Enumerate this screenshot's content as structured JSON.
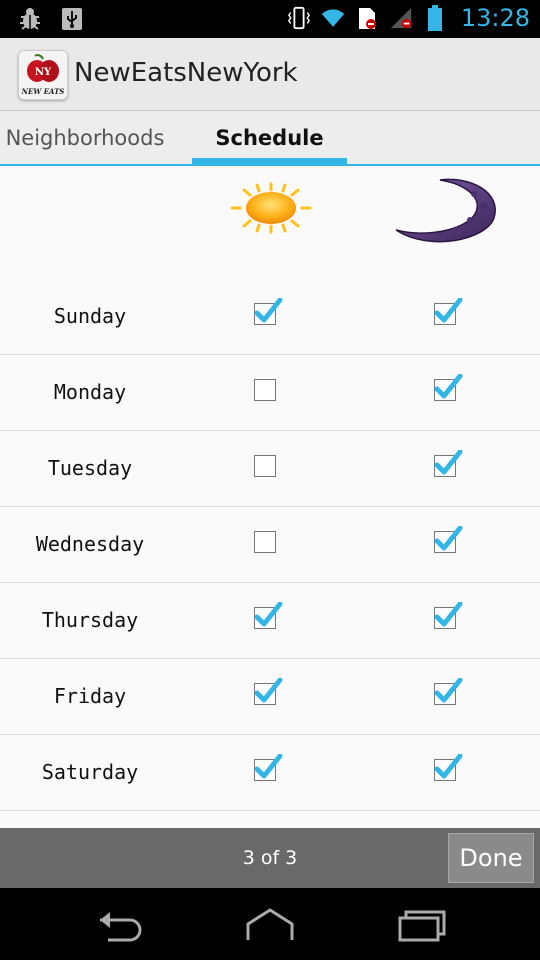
{
  "status_bar": {
    "time": "13:28",
    "left_icons": [
      "bug-icon",
      "usb-icon"
    ],
    "right_icons": [
      "vibrate-icon",
      "wifi-icon",
      "sd-card-icon",
      "no-signal-icon",
      "battery-icon"
    ],
    "accent": "#33b5e5"
  },
  "app": {
    "title": "NewEatsNewYork",
    "icon_text": "NEW EATS"
  },
  "tabs": [
    {
      "label": "Neighborhoods",
      "selected": false
    },
    {
      "label": "Schedule",
      "selected": true
    }
  ],
  "schedule": {
    "columns": [
      "sun-icon",
      "moon-icon"
    ],
    "rows": [
      {
        "day": "Sunday",
        "day_checked": true,
        "night_checked": true
      },
      {
        "day": "Monday",
        "day_checked": false,
        "night_checked": true
      },
      {
        "day": "Tuesday",
        "day_checked": false,
        "night_checked": true
      },
      {
        "day": "Wednesday",
        "day_checked": false,
        "night_checked": true
      },
      {
        "day": "Thursday",
        "day_checked": true,
        "night_checked": true
      },
      {
        "day": "Friday",
        "day_checked": true,
        "night_checked": true
      },
      {
        "day": "Saturday",
        "day_checked": true,
        "night_checked": true
      }
    ]
  },
  "footer": {
    "page_indicator": "3 of 3",
    "done_label": "Done"
  },
  "nav_bar": [
    "back-icon",
    "home-icon",
    "recent-apps-icon"
  ]
}
